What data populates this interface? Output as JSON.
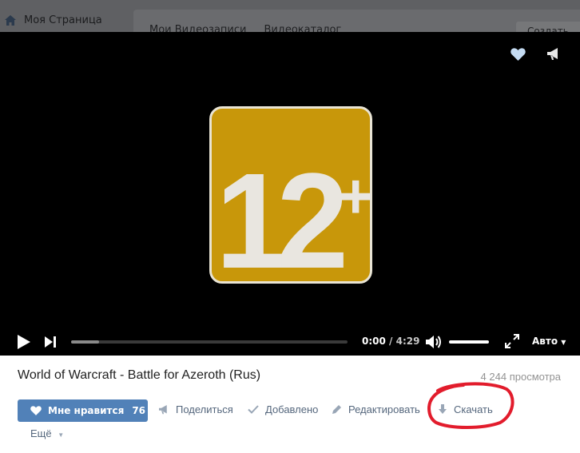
{
  "background": {
    "sidebar_item": "Моя Страница",
    "tabs": [
      "Мои Видеозаписи",
      "Видеокаталог"
    ],
    "create_button": "Создать ти"
  },
  "player": {
    "age_rating_number": "12",
    "age_rating_plus": "+",
    "time_current": "0:00",
    "time_separator": " / ",
    "time_total": "4:29",
    "quality": "Авто",
    "progress_loaded_fraction": 0.1
  },
  "video": {
    "title": "World of Warcraft - Battle for Azeroth (Rus)",
    "views": "4 244 просмотра"
  },
  "actions": {
    "like_label": "Мне нравится",
    "like_count": "76",
    "share": "Поделиться",
    "added": "Добавлено",
    "edit": "Редактировать",
    "download": "Скачать",
    "more": "Ещё"
  },
  "colors": {
    "accent": "#5181b8",
    "badge": "#c8970a",
    "link": "#55677d",
    "annotation": "#e21c2c"
  }
}
